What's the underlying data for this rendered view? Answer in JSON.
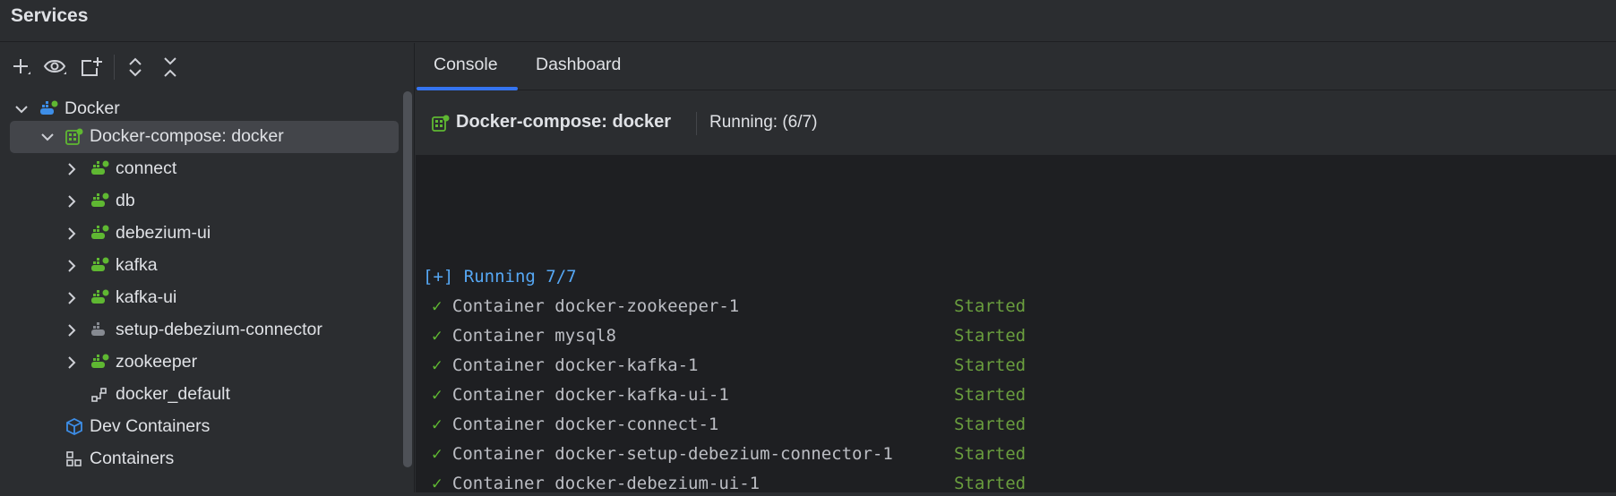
{
  "window": {
    "title": "Services"
  },
  "toolbar": {
    "buttons": [
      {
        "name": "add",
        "icon": "plus-icon"
      },
      {
        "name": "view",
        "icon": "eye-icon"
      },
      {
        "name": "new-tab",
        "icon": "add-tab-icon"
      },
      {
        "name": "expand-all",
        "icon": "expand-all-icon"
      },
      {
        "name": "collapse-all",
        "icon": "collapse-all-icon"
      }
    ]
  },
  "tree": {
    "docker": "Docker",
    "compose": "Docker-compose: docker",
    "services": [
      {
        "label": "connect",
        "running": true
      },
      {
        "label": "db",
        "running": true
      },
      {
        "label": "debezium-ui",
        "running": true
      },
      {
        "label": "kafka",
        "running": true
      },
      {
        "label": "kafka-ui",
        "running": true
      },
      {
        "label": "setup-debezium-connector",
        "running": false
      },
      {
        "label": "zookeeper",
        "running": true
      }
    ],
    "network": "docker_default",
    "dev_containers": "Dev Containers",
    "containers": "Containers"
  },
  "tabs": {
    "console": "Console",
    "dashboard": "Dashboard",
    "active": "Console"
  },
  "header": {
    "title": "Docker-compose: docker",
    "status": "Running: (6/7)"
  },
  "console": {
    "running_line": "[+] Running 7/7",
    "check": "✓",
    "lines": [
      {
        "text": "Container docker-zookeeper-1",
        "status": "Started"
      },
      {
        "text": "Container mysql8",
        "status": "Started"
      },
      {
        "text": "Container docker-kafka-1",
        "status": "Started"
      },
      {
        "text": "Container docker-kafka-ui-1",
        "status": "Started"
      },
      {
        "text": "Container docker-connect-1",
        "status": "Started"
      },
      {
        "text": "Container docker-setup-debezium-connector-1",
        "status": "Started"
      },
      {
        "text": "Container docker-debezium-ui-1",
        "status": "Started"
      }
    ]
  },
  "colors": {
    "accent": "#3574f0",
    "running_blue": "#56a8f5",
    "check_green": "#5fb832",
    "started_green": "#6a9e3e",
    "docker_blue": "#3d8ee8",
    "service_green": "#5fb832"
  }
}
